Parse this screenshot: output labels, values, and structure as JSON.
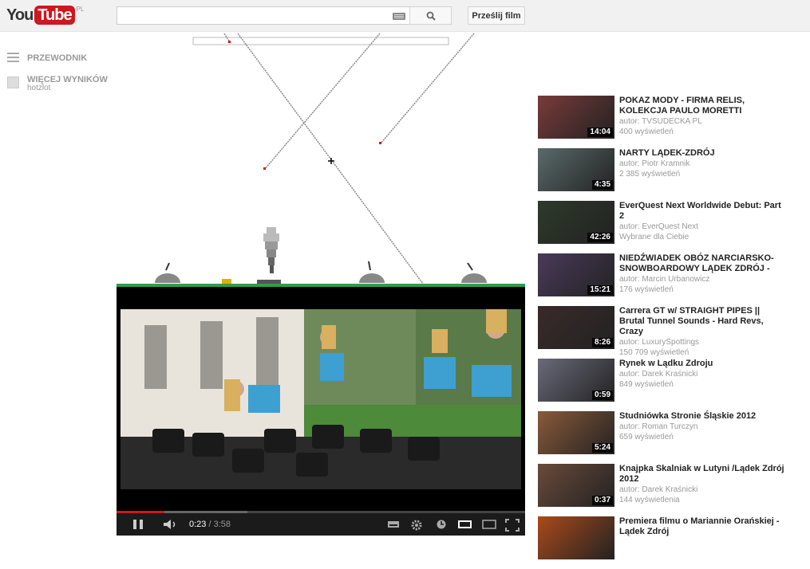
{
  "header": {
    "logo_you": "You",
    "logo_tube": "Tube",
    "logo_region": "PL",
    "search_value": "",
    "search_placeholder": "",
    "upload_label": "Prześlij film"
  },
  "guide": {
    "guide_label": "PRZEWODNIK",
    "more_label": "WIĘCEJ WYNIKÓW",
    "more_sub": "hotzlot"
  },
  "player": {
    "current_time": "0:23",
    "separator": "/",
    "total_time": "3:58",
    "progress_played": 0.117,
    "progress_loaded": 0.32
  },
  "recommendations": [
    {
      "title": "POKAZ MODY - FIRMA RELIS, KOLEKCJA PAULO MORETTI",
      "author": "autor: TVSUDECKA PL",
      "views": "400 wyświetleń",
      "duration": "14:04",
      "thumb_color": "#7a3a3a"
    },
    {
      "title": "NARTY LĄDEK-ZDRÓJ",
      "author": "autor: Piotr Kramnik",
      "views": "2 385 wyświetleń",
      "duration": "4:35",
      "thumb_color": "#5a6a6a"
    },
    {
      "title": "EverQuest Next Worldwide Debut: Part 2",
      "author": "autor: EverQuest Next",
      "views": "Wybrane dla Ciebie",
      "duration": "42:26",
      "thumb_color": "#2d3a2a"
    },
    {
      "title": "NIEDŹWIADEK OBÓZ NARCIARSKO-SNOWBOARDOWY LĄDEK ZDRÓJ -",
      "author": "autor: Marcin Urbanowicz",
      "views": "176 wyświetleń",
      "duration": "15:21",
      "thumb_color": "#4a3a5a"
    },
    {
      "title": "Carrera GT w/ STRAIGHT PIPES || Brutal Tunnel Sounds - Hard Revs, Crazy",
      "author": "autor: LuxurySpottings",
      "views": "150 709 wyświetleń",
      "duration": "8:26",
      "thumb_color": "#3a2a2a"
    },
    {
      "title": "Rynek w Lądku Zdroju",
      "author": "autor: Darek Kraśnicki",
      "views": "849 wyświetleń",
      "duration": "0:59",
      "thumb_color": "#6a6a7a"
    },
    {
      "title": "Studniówka Stronie Śląskie 2012",
      "author": "autor: Roman Turczyn",
      "views": "659 wyświetleń",
      "duration": "5:24",
      "thumb_color": "#8a5a3a"
    },
    {
      "title": "Knajpka Skalniak w Lutyni /Lądek Zdrój 2012",
      "author": "autor: Darek Kraśnicki",
      "views": "144 wyświetlenia",
      "duration": "0:37",
      "thumb_color": "#6a4a3a"
    },
    {
      "title": "Premiera filmu o Mariannie Orańskiej - Lądek Zdrój",
      "author": "",
      "views": "",
      "duration": "",
      "thumb_color": "#aa4a1a"
    }
  ]
}
